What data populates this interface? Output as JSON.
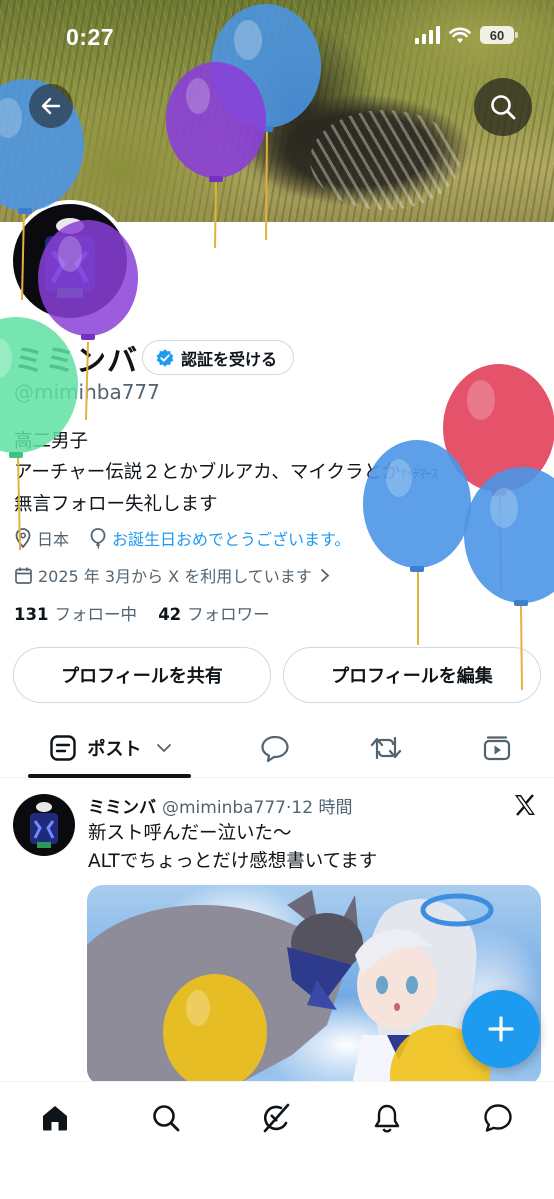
{
  "status_bar": {
    "time": "0:27",
    "battery": "60"
  },
  "profile": {
    "display_name": "ミミンバ",
    "verify_label": "認証を受ける",
    "handle": "@miminba777",
    "bio_line1": "高二男子",
    "bio_line2_main": "アーチャー伝説２とかブルアカ、マイクラとか",
    "bio_line2_small": "ﾔｯﾃﾏｰｽ",
    "bio_line3": "無言フォロー失礼します",
    "location": "日本",
    "birthday_text": "お誕生日おめでとうございます。",
    "joined": "2025 年 3月から X を利用しています",
    "following_count": "131",
    "following_label": "フォロー中",
    "followers_count": "42",
    "followers_label": "フォロワー"
  },
  "actions": {
    "share_label": "プロフィールを共有",
    "edit_label": "プロフィールを編集"
  },
  "tabs": {
    "posts_label": "ポスト"
  },
  "post": {
    "name": "ミミンバ",
    "handle": "@miminba777",
    "sep": "·",
    "time": "12 時間",
    "line1": "新スト呼んだー泣いた〜",
    "line2": "ALTでちょっとだけ感想書いてます"
  },
  "icons": {
    "back": "back-arrow-icon",
    "search": "search-icon",
    "verified": "verified-badge-icon",
    "location": "location-pin-icon",
    "balloon": "balloon-icon",
    "calendar": "calendar-icon",
    "chevron": "chevron-right-icon",
    "x_logo": "x-logo-icon",
    "compose": "plus-icon",
    "home": "home-icon",
    "explore": "search-icon",
    "grok": "grok-icon",
    "notifications": "bell-icon",
    "messages": "message-icon"
  },
  "colors": {
    "accent": "#1d9bf0",
    "text": "#0f1419",
    "muted": "#536471",
    "border": "#cfd9de"
  }
}
